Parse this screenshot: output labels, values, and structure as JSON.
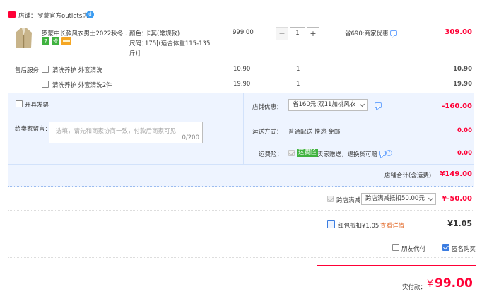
{
  "shop": {
    "label": "店铺：",
    "name": "罗蒙官方outlets店",
    "badge": "d"
  },
  "item": {
    "title": "罗蒙中长款风衣男士2022秋冬...",
    "color_label": "颜色：",
    "color_value": "卡其(常规款)",
    "size_label": "尺码：",
    "size_value": "175[(适合体重115-135",
    "size_value_2": "斤)]",
    "price": "999.00",
    "qty": "1",
    "minus": "−",
    "plus": "+",
    "promo": "省690:商家优惠",
    "subtotal": "309.00",
    "tags": [
      "7",
      "修",
      "卡"
    ]
  },
  "services": {
    "label": "售后服务",
    "rows": [
      {
        "name": "清洗养护 外套清洗",
        "price": "10.90",
        "qty": "1",
        "total": "10.90"
      },
      {
        "name": "清洗养护 外套清洗2件",
        "price": "19.90",
        "qty": "1",
        "total": "19.90"
      }
    ]
  },
  "invoice": {
    "label": "开具发票"
  },
  "shop_discount": {
    "label": "店铺优惠：",
    "value": "省160元:双11加桃风衣",
    "amount": "-160.00"
  },
  "message": {
    "label": "给卖家留言：",
    "placeholder": "选填，请先和商家协商一致，付款后商家可见",
    "count": "0/200"
  },
  "shipping": {
    "label": "运送方式：",
    "value": "普通配送 快递 免邮",
    "amount": "0.00"
  },
  "insurance": {
    "label": "运费险：",
    "badge": "运费险",
    "text": "卖家赠送，退换货可赔",
    "amount": "0.00"
  },
  "shop_total": {
    "label": "店铺合计(含运费)",
    "amount": "¥149.00"
  },
  "cross_store": {
    "label": "跨店满减",
    "value": "跨店满减抵扣50.00元",
    "amount": "¥-50.00"
  },
  "redpacket": {
    "label": "红包抵扣¥1.05",
    "link": "查看详情",
    "amount": "¥1.05"
  },
  "options": {
    "friend_pay": "朋友代付",
    "anonymous": "匿名购买"
  },
  "final": {
    "label": "实付款：",
    "currency": "¥",
    "amount": "99.00"
  },
  "colors": {
    "accent": "#ff0036",
    "panel": "#eef4ff",
    "border": "#b2d1ff"
  }
}
